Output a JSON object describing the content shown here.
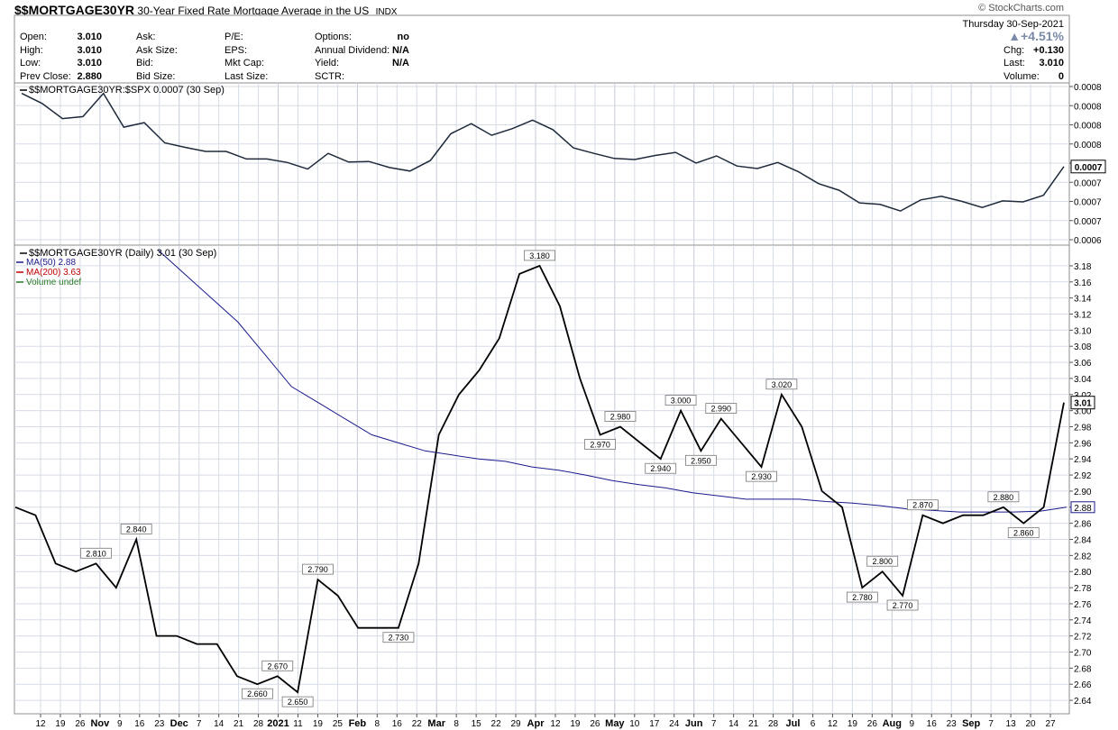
{
  "header": {
    "symbol": "$$MORTGAGE30YR",
    "description": "30-Year Fixed Rate Mortgage Average in the US",
    "exchange": "INDX",
    "brand": "© StockCharts.com",
    "date": "Thursday  30-Sep-2021",
    "pct_change": "▲+4.51%",
    "quote_left": [
      {
        "label": "Open:",
        "value": "3.010"
      },
      {
        "label": "High:",
        "value": "3.010"
      },
      {
        "label": "Low:",
        "value": "3.010"
      },
      {
        "label": "Prev Close:",
        "value": "2.880"
      }
    ],
    "quote_mid": [
      "Ask:",
      "Ask Size:",
      "Bid:",
      "Bid Size:"
    ],
    "quote_mid2": [
      "P/E:",
      "EPS:",
      "Mkt Cap:",
      "Last Size:"
    ],
    "quote_opts": [
      {
        "label": "Options:",
        "value": "no"
      },
      {
        "label": "Annual Dividend:",
        "value": "N/A"
      },
      {
        "label": "Yield:",
        "value": "N/A"
      },
      {
        "label": "SCTR:",
        "value": ""
      }
    ],
    "quote_right": [
      {
        "label": "Chg:",
        "value": "+0.130"
      },
      {
        "label": "Last:",
        "value": "3.010"
      },
      {
        "label": "Volume:",
        "value": "0"
      }
    ]
  },
  "colors": {
    "price": "#000000",
    "ma50": "#1a1a8c",
    "ma200": "#c00000",
    "grid": "#d6dce6",
    "frame": "#8c8c8c",
    "volume": "#2a7a2a"
  },
  "chart_data": [
    {
      "type": "line",
      "title": "$$MORTGAGE30YR:$SPX 0.0007 (30 Sep)",
      "last_label": "0.0007",
      "ylim": [
        0.00055,
        0.00085
      ],
      "yticks": [
        "0.0006",
        "0.0007",
        "0.0007",
        "0.0007",
        "0.0007",
        "0.0008",
        "0.0008",
        "0.0008",
        "0.0008"
      ],
      "series": [
        {
          "values": [
            0.00084,
            0.00082,
            0.00079,
            0.000794,
            0.00084,
            0.000773,
            0.000782,
            0.000742,
            0.000733,
            0.000725,
            0.000725,
            0.00071,
            0.00071,
            0.000703,
            0.00069,
            0.000721,
            0.000704,
            0.000705,
            0.000693,
            0.000686,
            0.000707,
            0.00076,
            0.00078,
            0.000757,
            0.00077,
            0.000787,
            0.000768,
            0.000732,
            0.000721,
            0.000711,
            0.000709,
            0.000717,
            0.000723,
            0.000702,
            0.000716,
            0.000696,
            0.000691,
            0.000703,
            0.000685,
            0.000661,
            0.000648,
            0.000623,
            0.00062,
            0.000607,
            0.000629,
            0.000636,
            0.000626,
            0.000614,
            0.000627,
            0.000625,
            0.000638,
            0.000695
          ]
        }
      ]
    },
    {
      "type": "line",
      "title": "$$MORTGAGE30YR (Daily) 3.01 (30 Sep)",
      "legend": [
        {
          "name": "MA(50) 2.88",
          "color": "#1a1a8c"
        },
        {
          "name": "MA(200) 3.63",
          "color": "#c00000"
        },
        {
          "name": "Volume undef",
          "color": "#2a7a2a"
        }
      ],
      "ylim": [
        2.63,
        3.19
      ],
      "yticks": [
        "2.64",
        "2.66",
        "2.68",
        "2.70",
        "2.72",
        "2.74",
        "2.76",
        "2.78",
        "2.80",
        "2.82",
        "2.84",
        "2.86",
        "2.88",
        "2.90",
        "2.92",
        "2.94",
        "2.96",
        "2.98",
        "3.00",
        "3.02",
        "3.04",
        "3.06",
        "3.08",
        "3.10",
        "3.12",
        "3.14",
        "3.16",
        "3.18"
      ],
      "last_label": "3.01",
      "ma_label": "2.88",
      "series": [
        {
          "name": "$$MORTGAGE30YR",
          "values": [
            2.88,
            2.87,
            2.81,
            2.8,
            2.81,
            2.78,
            2.84,
            2.72,
            2.72,
            2.71,
            2.71,
            2.67,
            2.66,
            2.67,
            2.65,
            2.79,
            2.77,
            2.73,
            2.73,
            2.73,
            2.81,
            2.97,
            3.02,
            3.05,
            3.09,
            3.17,
            3.18,
            3.13,
            3.04,
            2.97,
            2.98,
            2.96,
            2.94,
            3.0,
            2.95,
            2.99,
            2.96,
            2.93,
            3.02,
            2.98,
            2.9,
            2.88,
            2.78,
            2.8,
            2.77,
            2.87,
            2.86,
            2.87,
            2.87,
            2.88,
            2.86,
            2.88,
            3.01
          ]
        },
        {
          "name": "MA(50)",
          "values": [
            3.2,
            3.17,
            3.14,
            3.11,
            3.07,
            3.03,
            3.01,
            2.99,
            2.97,
            2.96,
            2.95,
            2.945,
            2.94,
            2.937,
            2.93,
            2.926,
            2.92,
            2.913,
            2.908,
            2.904,
            2.898,
            2.894,
            2.89,
            2.89,
            2.89,
            2.887,
            2.885,
            2.882,
            2.878,
            2.876,
            2.874,
            2.874,
            2.874,
            2.875,
            2.88
          ]
        }
      ],
      "labels": [
        {
          "i": 4,
          "text": "2.810"
        },
        {
          "i": 6,
          "text": "2.840"
        },
        {
          "i": 12,
          "text": "2.660"
        },
        {
          "i": 13,
          "text": "2.670"
        },
        {
          "i": 14,
          "text": "2.650"
        },
        {
          "i": 15,
          "text": "2.790"
        },
        {
          "i": 19,
          "text": "2.730"
        },
        {
          "i": 26,
          "text": "3.180"
        },
        {
          "i": 29,
          "text": "2.970"
        },
        {
          "i": 30,
          "text": "2.980"
        },
        {
          "i": 32,
          "text": "2.940"
        },
        {
          "i": 33,
          "text": "3.000"
        },
        {
          "i": 34,
          "text": "2.950"
        },
        {
          "i": 35,
          "text": "2.990"
        },
        {
          "i": 37,
          "text": "2.930"
        },
        {
          "i": 38,
          "text": "3.020"
        },
        {
          "i": 42,
          "text": "2.780"
        },
        {
          "i": 43,
          "text": "2.800"
        },
        {
          "i": 44,
          "text": "2.770"
        },
        {
          "i": 45,
          "text": "2.870"
        },
        {
          "i": 49,
          "text": "2.880"
        },
        {
          "i": 50,
          "text": "2.860"
        }
      ]
    }
  ],
  "x_axis": [
    {
      "t": "12",
      "b": false
    },
    {
      "t": "19",
      "b": false
    },
    {
      "t": "26",
      "b": false
    },
    {
      "t": "Nov",
      "b": true
    },
    {
      "t": "9",
      "b": false
    },
    {
      "t": "16",
      "b": false
    },
    {
      "t": "23",
      "b": false
    },
    {
      "t": "Dec",
      "b": true
    },
    {
      "t": "7",
      "b": false
    },
    {
      "t": "14",
      "b": false
    },
    {
      "t": "21",
      "b": false
    },
    {
      "t": "28",
      "b": false
    },
    {
      "t": "2021",
      "b": true
    },
    {
      "t": "11",
      "b": false
    },
    {
      "t": "19",
      "b": false
    },
    {
      "t": "25",
      "b": false
    },
    {
      "t": "Feb",
      "b": true
    },
    {
      "t": "8",
      "b": false
    },
    {
      "t": "16",
      "b": false
    },
    {
      "t": "22",
      "b": false
    },
    {
      "t": "Mar",
      "b": true
    },
    {
      "t": "8",
      "b": false
    },
    {
      "t": "15",
      "b": false
    },
    {
      "t": "22",
      "b": false
    },
    {
      "t": "29",
      "b": false
    },
    {
      "t": "Apr",
      "b": true
    },
    {
      "t": "12",
      "b": false
    },
    {
      "t": "19",
      "b": false
    },
    {
      "t": "26",
      "b": false
    },
    {
      "t": "May",
      "b": true
    },
    {
      "t": "10",
      "b": false
    },
    {
      "t": "17",
      "b": false
    },
    {
      "t": "24",
      "b": false
    },
    {
      "t": "Jun",
      "b": true
    },
    {
      "t": "7",
      "b": false
    },
    {
      "t": "14",
      "b": false
    },
    {
      "t": "21",
      "b": false
    },
    {
      "t": "28",
      "b": false
    },
    {
      "t": "Jul",
      "b": true
    },
    {
      "t": "6",
      "b": false
    },
    {
      "t": "12",
      "b": false
    },
    {
      "t": "19",
      "b": false
    },
    {
      "t": "26",
      "b": false
    },
    {
      "t": "Aug",
      "b": true
    },
    {
      "t": "9",
      "b": false
    },
    {
      "t": "16",
      "b": false
    },
    {
      "t": "23",
      "b": false
    },
    {
      "t": "Sep",
      "b": true
    },
    {
      "t": "7",
      "b": false
    },
    {
      "t": "13",
      "b": false
    },
    {
      "t": "20",
      "b": false
    },
    {
      "t": "27",
      "b": false
    }
  ]
}
